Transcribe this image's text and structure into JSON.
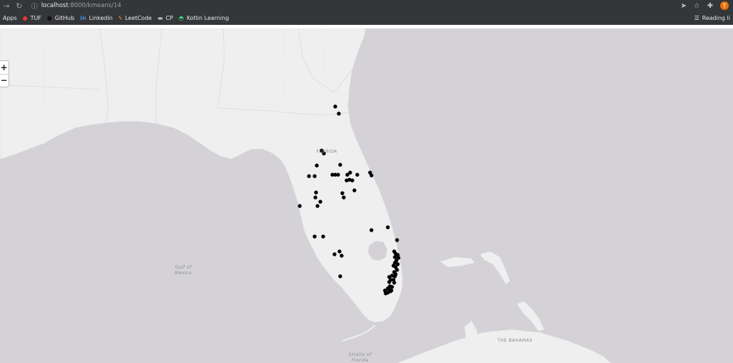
{
  "browser": {
    "url_host": "localhost",
    "url_path": ":8000/kmeans/14",
    "back_icon": "arrow-right-icon",
    "reload_icon": "reload-icon",
    "profile_initial": "T"
  },
  "bookmarks": [
    {
      "label": "Apps"
    },
    {
      "label": "TUF"
    },
    {
      "label": "GitHub"
    },
    {
      "label": "Linkedin"
    },
    {
      "label": "LeetCode"
    },
    {
      "label": "CP"
    },
    {
      "label": "Kotlin Learning"
    }
  ],
  "reading_list": "Reading li",
  "map": {
    "zoom_in": "+",
    "zoom_out": "−",
    "labels": {
      "state": "FLORIDA",
      "gulf": "Gulf of\nMexico",
      "bahamas": "THE BAHAMAS",
      "straits": "Straits of\nFlorida"
    },
    "marker_color": "#000000"
  }
}
